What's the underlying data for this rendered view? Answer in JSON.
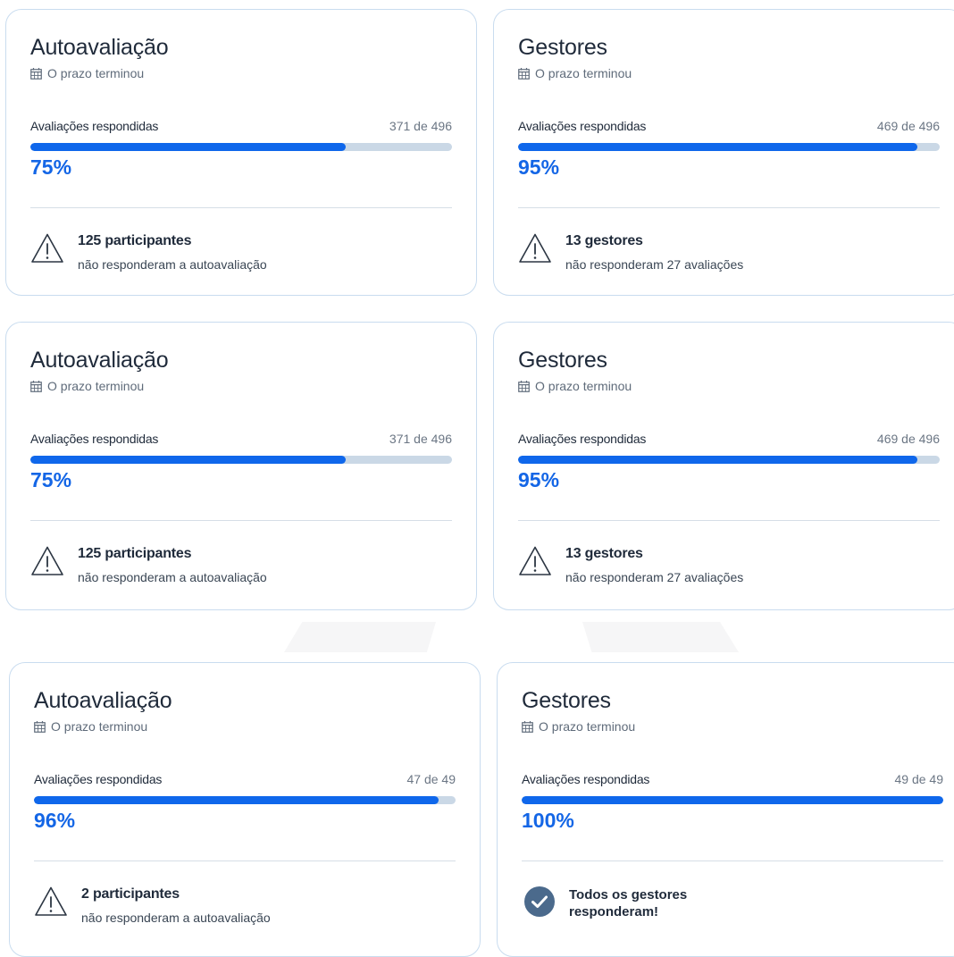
{
  "colors": {
    "accent": "#0f67eb",
    "track": "#cad8e6",
    "border": "#c9dcef",
    "check_badge": "#4b6a8c"
  },
  "cards": [
    {
      "title": "Autoavaliação",
      "deadline": "O prazo terminou",
      "progress_label": "Avaliações respondidas",
      "progress_count": "371 de 496",
      "progress_fraction": 0.748,
      "percent": "75%",
      "status_icon": "warning-icon",
      "status_main": "125 participantes",
      "status_sub": "não responderam a autoavaliação"
    },
    {
      "title": "Gestores",
      "deadline": "O prazo terminou",
      "progress_label": "Avaliações respondidas",
      "progress_count": "469 de 496",
      "progress_fraction": 0.946,
      "percent": "95%",
      "status_icon": "warning-icon",
      "status_main": "13 gestores",
      "status_sub": "não responderam 27 avaliações"
    },
    {
      "title": "Autoavaliação",
      "deadline": "O prazo terminou",
      "progress_label": "Avaliações respondidas",
      "progress_count": "371 de 496",
      "progress_fraction": 0.748,
      "percent": "75%",
      "status_icon": "warning-icon",
      "status_main": "125 participantes",
      "status_sub": "não responderam a autoavaliação"
    },
    {
      "title": "Gestores",
      "deadline": "O prazo terminou",
      "progress_label": "Avaliações respondidas",
      "progress_count": "469 de 496",
      "progress_fraction": 0.946,
      "percent": "95%",
      "status_icon": "warning-icon",
      "status_main": "13 gestores",
      "status_sub": "não responderam 27 avaliações"
    },
    {
      "title": "Autoavaliação",
      "deadline": "O prazo terminou",
      "progress_label": "Avaliações respondidas",
      "progress_count": "47 de 49",
      "progress_fraction": 0.96,
      "percent": "96%",
      "status_icon": "warning-icon",
      "status_main": "2 participantes",
      "status_sub": "não responderam a autoavaliação"
    },
    {
      "title": "Gestores",
      "deadline": "O prazo terminou",
      "progress_label": "Avaliações respondidas",
      "progress_count": "49 de 49",
      "progress_fraction": 1.0,
      "percent": "100%",
      "status_icon": "check-circle-icon",
      "status_main_line1": "Todos os gestores",
      "status_main_line2": "responderam!"
    }
  ]
}
